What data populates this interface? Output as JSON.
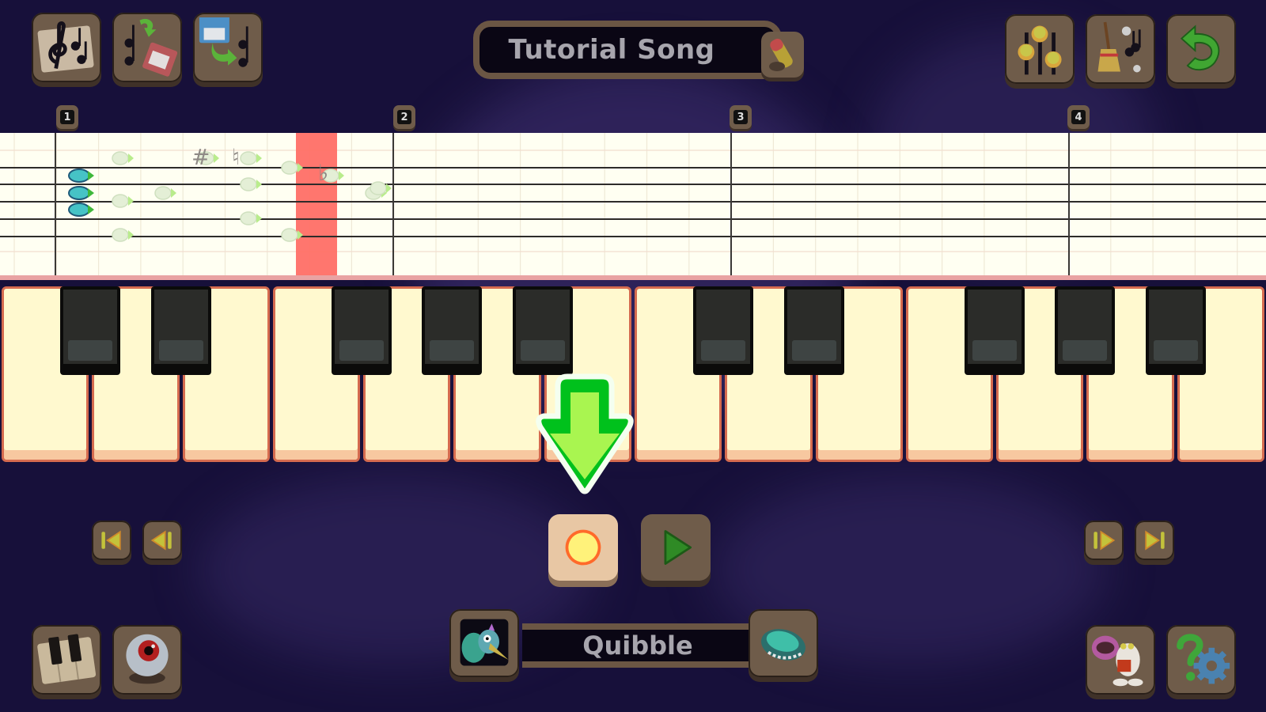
{
  "song": {
    "title": "Tutorial Song"
  },
  "top_left_toolbar": [
    {
      "name": "song-sheet-button",
      "icon": "sheet-music-icon"
    },
    {
      "name": "save-song-button",
      "icon": "save-music-icon"
    },
    {
      "name": "load-song-button",
      "icon": "load-music-icon"
    }
  ],
  "top_right_toolbar": [
    {
      "name": "mixer-button",
      "icon": "mixer-sliders-icon"
    },
    {
      "name": "clear-notes-button",
      "icon": "broom-icon"
    },
    {
      "name": "undo-button",
      "icon": "undo-arrow-icon"
    }
  ],
  "title_edit_icon": "pencil-icon",
  "measures": [
    "1",
    "2",
    "3",
    "4"
  ],
  "staff": {
    "playhead_color": "#ff6f66",
    "accidentals": [
      "#",
      "♮",
      "♭"
    ],
    "placed_note_count": 3
  },
  "keyboard": {
    "white_keys": 14,
    "black_keys": 10
  },
  "transport": {
    "rewind_start": "skip-to-start-icon",
    "step_back": "step-back-icon",
    "record": "record-icon",
    "play": "play-icon",
    "step_forward": "step-forward-icon",
    "skip_end": "skip-to-end-icon"
  },
  "monster": {
    "name": "Quibble",
    "portrait": "quibble-portrait-icon",
    "egg": "monster-egg-icon"
  },
  "bottom_left": [
    {
      "name": "keyboard-mode-button",
      "icon": "piano-keys-icon"
    },
    {
      "name": "view-button",
      "icon": "eyeball-icon"
    }
  ],
  "bottom_right": [
    {
      "name": "monster-select-button",
      "icon": "monster-icon"
    },
    {
      "name": "help-settings-button",
      "icon": "help-gear-icon"
    }
  ],
  "colors": {
    "background": "#17103a",
    "tile": "#6f5c4a",
    "staff_bg": "#fffff2",
    "white_key": "#fff9cf",
    "key_border": "#d56b4f",
    "hint_arrow": "#00c11c"
  }
}
